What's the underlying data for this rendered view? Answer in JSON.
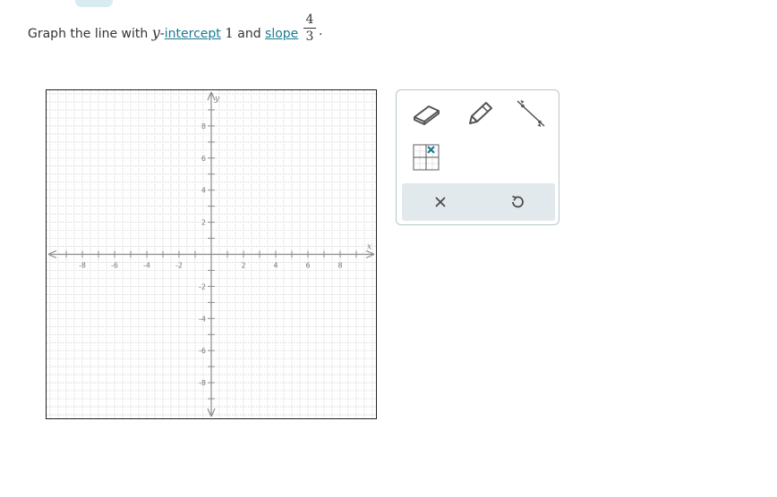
{
  "prompt": {
    "lead": "Graph the line with ",
    "y_var": "y",
    "dash": "-",
    "intercept_link": "intercept",
    "intercept_value": "1",
    "and": " and ",
    "slope_link": "slope",
    "slope_numerator": "4",
    "slope_denominator": "3",
    "period": "."
  },
  "graph": {
    "x_axis_label": "x",
    "y_axis_label": "y",
    "x_range": [
      -10,
      10
    ],
    "y_range": [
      -10,
      10
    ],
    "tick_labels_x": [
      "-8",
      "-6",
      "-4",
      "-2",
      "2",
      "4",
      "6",
      "8"
    ],
    "tick_labels_y": [
      "8",
      "6",
      "4",
      "2",
      "-2",
      "-4",
      "-6",
      "-8"
    ],
    "grid": true
  },
  "toolbar": {
    "eraser_tool": "eraser-icon",
    "pencil_tool": "pencil-icon",
    "line_tool": "line-segment-icon",
    "no_solution_tool": "no-solution-grid-icon",
    "clear_button": "close-icon",
    "undo_button": "undo-icon"
  },
  "colors": {
    "link": "#1a7a92",
    "tool_border": "#b9c7cc",
    "action_bar": "#e2e9ec",
    "grid": "#c8c8c8",
    "axis": "#8a8a8a"
  }
}
